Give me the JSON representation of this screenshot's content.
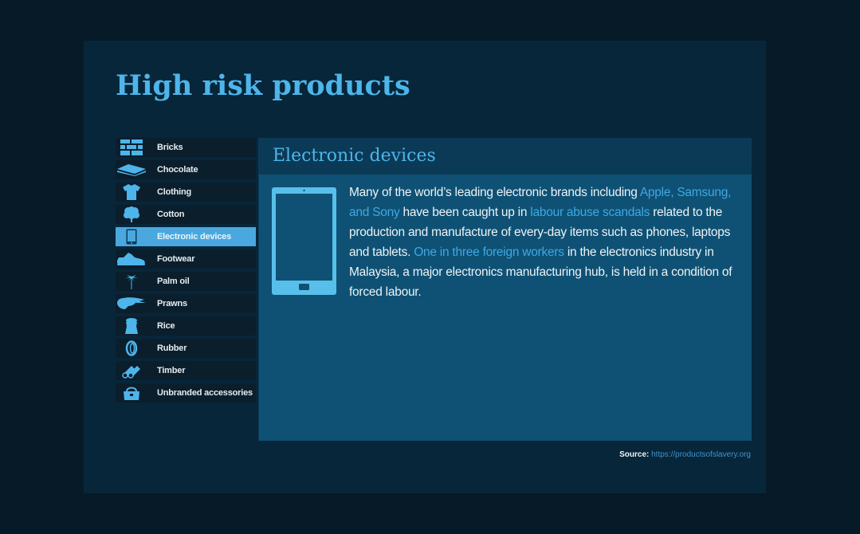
{
  "colors": {
    "page_bg": "#061a27",
    "card_bg": "#07263a",
    "accent": "#4db5ea",
    "active_item_bg": "#4aa8df",
    "panel_bg": "#0e5174",
    "panel_header_bg": "#0b3a57",
    "link": "#3fa8e3"
  },
  "page_title": "High risk products",
  "sidebar": {
    "items": [
      {
        "label": "Bricks",
        "icon": "bricks-icon",
        "active": false
      },
      {
        "label": "Chocolate",
        "icon": "chocolate-bar-icon",
        "active": false
      },
      {
        "label": "Clothing",
        "icon": "tshirt-icon",
        "active": false
      },
      {
        "label": "Cotton",
        "icon": "cotton-plant-icon",
        "active": false
      },
      {
        "label": "Electronic devices",
        "icon": "tablet-icon",
        "active": true
      },
      {
        "label": "Footwear",
        "icon": "sneaker-icon",
        "active": false
      },
      {
        "label": "Palm oil",
        "icon": "palm-tree-icon",
        "active": false
      },
      {
        "label": "Prawns",
        "icon": "prawn-icon",
        "active": false
      },
      {
        "label": "Rice",
        "icon": "rice-sack-icon",
        "active": false
      },
      {
        "label": "Rubber",
        "icon": "tyre-icon",
        "active": false
      },
      {
        "label": "Timber",
        "icon": "logs-icon",
        "active": false
      },
      {
        "label": "Unbranded accessories",
        "icon": "handbag-icon",
        "active": false
      }
    ]
  },
  "detail": {
    "title": "Electronic devices",
    "illustration": "tablet-icon",
    "description": {
      "t1": "Many of the world’s leading electronic brands including ",
      "link1": "Apple, Samsung, and Sony",
      "t2": " have been caught up in ",
      "link2": "labour abuse scandals",
      "t3": " related to the production and manufacture of every-day items such as phones, laptops and tablets. ",
      "link3": "One in three foreign workers",
      "t4": " in the electronics industry in Malaysia, a major electronics manufacturing hub, is held in a condition of forced labour."
    }
  },
  "source": {
    "label": "Source:",
    "link_text": "https://productsofslavery.org"
  }
}
